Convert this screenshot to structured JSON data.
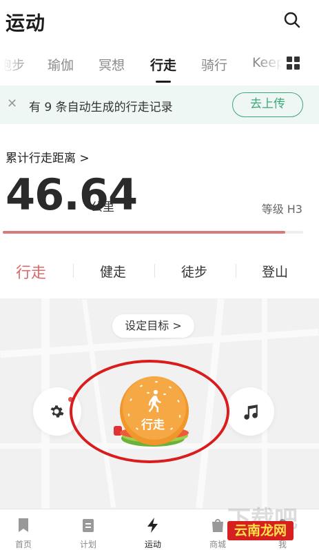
{
  "header": {
    "title": "运动",
    "search_icon": "search-icon"
  },
  "tabs": [
    {
      "label": "跑步"
    },
    {
      "label": "瑜伽"
    },
    {
      "label": "冥想"
    },
    {
      "label": "行走",
      "active": true
    },
    {
      "label": "骑行"
    },
    {
      "label": "Keep"
    }
  ],
  "banner": {
    "close_icon": "close-icon",
    "message": "有 9 条自动生成的行走记录",
    "action_label": "去上传"
  },
  "stats": {
    "cumulative_label": "累计行走距离 >",
    "distance": "46.64",
    "unit": "公里",
    "level": "等级 H3",
    "level_progress": 0.94,
    "progress_color": "#d97a7a"
  },
  "modes": [
    {
      "label": "行走",
      "active": true
    },
    {
      "label": "健走"
    },
    {
      "label": "徒步"
    },
    {
      "label": "登山"
    }
  ],
  "map": {
    "goal_label": "设定目标 >",
    "settings_icon": "gear-icon",
    "music_icon": "music-note-icon",
    "start_label": "行走",
    "start_icon": "walking-person-icon"
  },
  "bottom_nav": [
    {
      "label": "首页",
      "icon": "bookmark-icon"
    },
    {
      "label": "计划",
      "icon": "clipboard-icon"
    },
    {
      "label": "运动",
      "icon": "lightning-icon",
      "active": true
    },
    {
      "label": "商城",
      "icon": "shopping-bag-icon"
    },
    {
      "label": "我",
      "icon": "user-icon"
    }
  ],
  "watermark": {
    "text": "云南龙网",
    "ghost_text": "下载吧"
  },
  "colors": {
    "accent_green": "#3aa876",
    "accent_red": "#d96a6a",
    "highlight_ring": "#d91c1c"
  }
}
